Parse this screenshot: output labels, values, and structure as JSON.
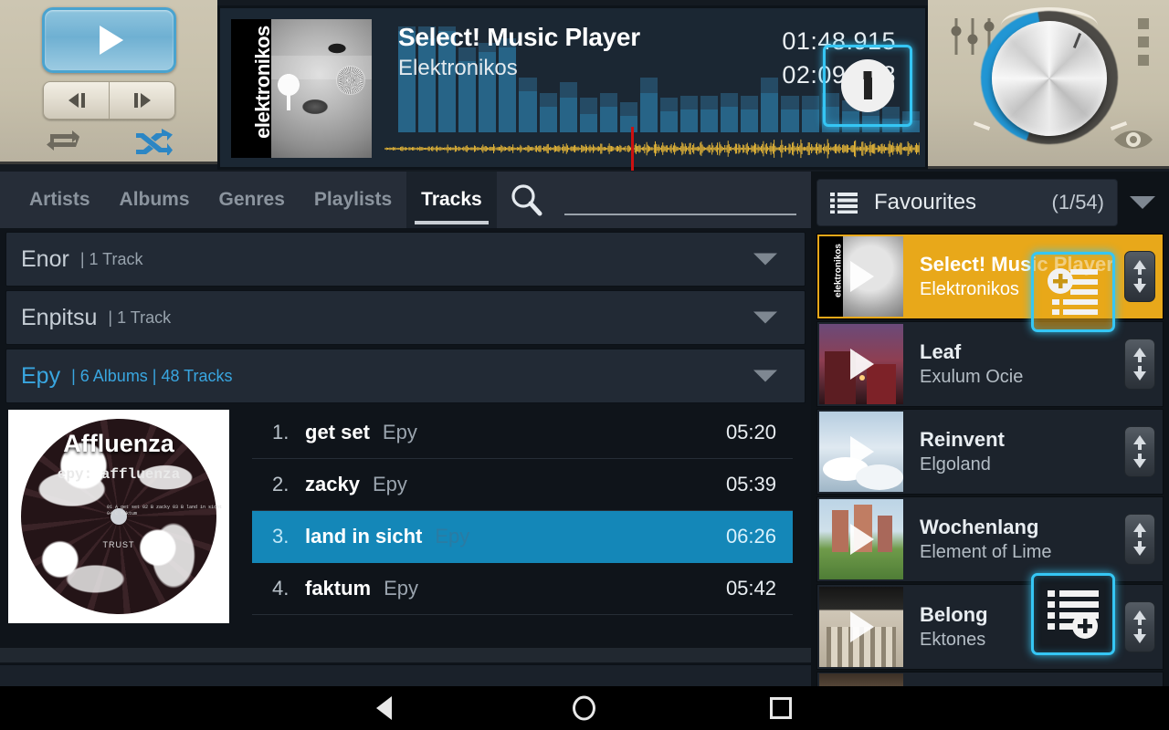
{
  "player": {
    "play_button": "play-icon",
    "prev_label": "previous-track",
    "next_label": "next-track",
    "repeat_label": "repeat",
    "shuffle_label": "shuffle",
    "now_playing_title": "Select! Music Player",
    "now_playing_artist": "Elektronikos",
    "elapsed_time": "01:48.915",
    "remaining_time": "02:09.268",
    "album_art_label": "elektronikos",
    "info_button": "info-icon",
    "playhead_percent": 46,
    "spectrum_levels": [
      88,
      82,
      88,
      62,
      70,
      74,
      36,
      22,
      30,
      16,
      22,
      14,
      34,
      18,
      20,
      20,
      22,
      20,
      34,
      20,
      20,
      22,
      18,
      14,
      12,
      10
    ],
    "spectrum_peaks": [
      92,
      92,
      92,
      74,
      78,
      82,
      48,
      34,
      44,
      30,
      34,
      26,
      48,
      30,
      32,
      32,
      34,
      32,
      48,
      32,
      32,
      34,
      28,
      24,
      22,
      18
    ]
  },
  "knob_panel": {
    "equalizer_icon": "equalizer-sliders-icon",
    "overflow_icon": "overflow-menu-icon",
    "volume_knob": "volume-knob",
    "eye_icon": "visibility-eye-icon"
  },
  "library": {
    "tabs": [
      {
        "label": "Artists",
        "active": false
      },
      {
        "label": "Albums",
        "active": false
      },
      {
        "label": "Genres",
        "active": false
      },
      {
        "label": "Playlists",
        "active": false
      },
      {
        "label": "Tracks",
        "active": true
      }
    ],
    "search": {
      "value": "",
      "placeholder": ""
    },
    "groups": [
      {
        "name": "Enor",
        "meta": "| 1 Track",
        "selected": false
      },
      {
        "name": "Enpitsu",
        "meta": "| 1 Track",
        "selected": false
      },
      {
        "name": "Epy",
        "meta": "| 6 Albums | 48 Tracks",
        "selected": true
      }
    ],
    "album": {
      "title": "Affluenza",
      "label_text": "epy: affluenza",
      "label_lines": "01 A get set\n02 B zacky\n03 B land in sicht\n04 C faktum"
    },
    "tracks": [
      {
        "num": "1.",
        "name": "get set",
        "artist": "Epy",
        "duration": "05:20",
        "selected": false
      },
      {
        "num": "2.",
        "name": "zacky",
        "artist": "Epy",
        "duration": "05:39",
        "selected": false
      },
      {
        "num": "3.",
        "name": "land in sicht",
        "artist": "Epy",
        "duration": "06:26",
        "selected": true
      },
      {
        "num": "4.",
        "name": "faktum",
        "artist": "Epy",
        "duration": "05:42",
        "selected": false
      }
    ]
  },
  "favourites": {
    "icon": "list-icon",
    "title": "Favourites",
    "count": "(1/54)",
    "items": [
      {
        "title": "Select! Music Player",
        "artist": "Elektronikos",
        "current": true,
        "art": "art-elek",
        "art_label": "elektronikos"
      },
      {
        "title": "Leaf",
        "artist": "Exulum Ocie",
        "current": false,
        "art": "art-leaf",
        "art_label": ""
      },
      {
        "title": "Reinvent",
        "artist": "Elgoland",
        "current": false,
        "art": "art-rein",
        "art_label": ""
      },
      {
        "title": "Wochenlang",
        "artist": "Element of Lime",
        "current": false,
        "art": "art-woch",
        "art_label": ""
      },
      {
        "title": "Belong",
        "artist": "Ektones",
        "current": false,
        "art": "art-bel",
        "art_label": ""
      }
    ],
    "add_to_playlist_label": "add-to-playlist",
    "drag_handle_label": "reorder-handle"
  },
  "navbar": {
    "back": "back-icon",
    "home": "home-icon",
    "recents": "recents-icon"
  },
  "colors": {
    "accent_blue": "#1487b8",
    "highlight_cyan": "#35c6f4",
    "current_yellow": "#e8a81a",
    "panel_dark": "#161c24"
  }
}
